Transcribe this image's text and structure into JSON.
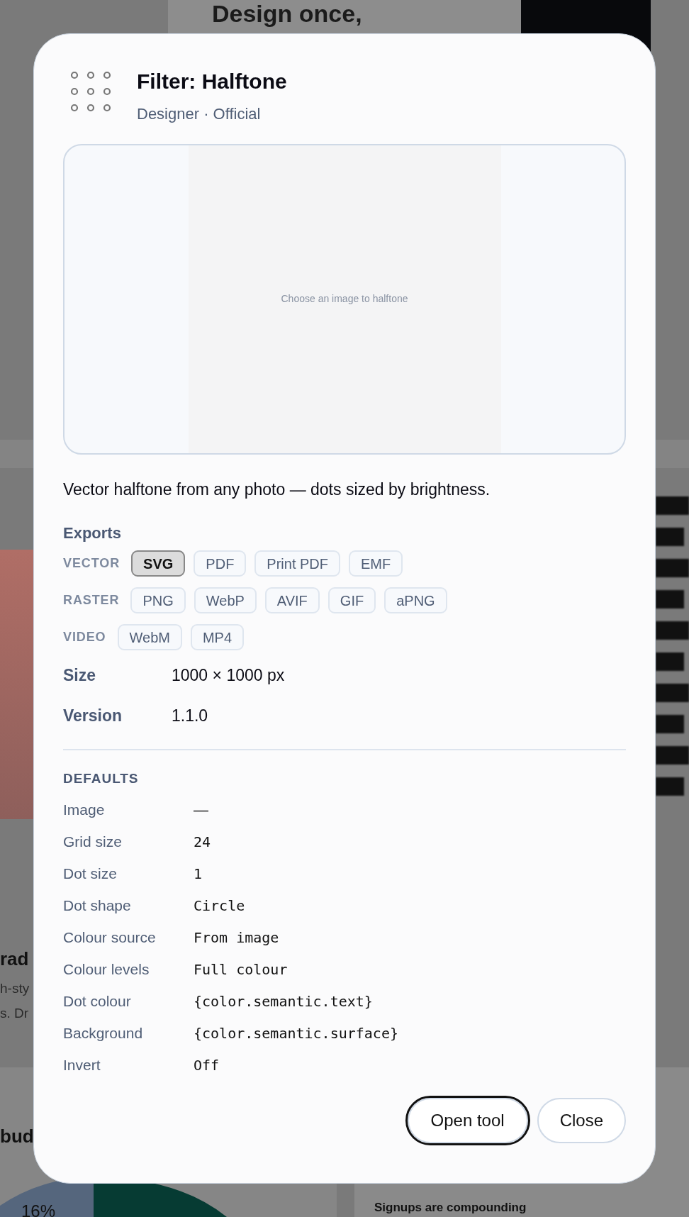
{
  "background": {
    "headline": "Design once,",
    "fragments": [
      {
        "kind": "title",
        "text": "rad"
      },
      {
        "kind": "body",
        "text": "h-sty"
      },
      {
        "kind": "body",
        "text": "s. Dr"
      },
      {
        "kind": "title",
        "text": "bud"
      }
    ],
    "chart_label": "16%",
    "card_title": "Signups are compounding"
  },
  "dialog": {
    "title": "Filter: Halftone",
    "subtitle": "Designer · Official",
    "preview_placeholder": "Choose an image to halftone",
    "description": "Vector halftone from any photo — dots sized by brightness.",
    "exports_heading": "Exports",
    "export_groups": [
      {
        "label": "VECTOR",
        "formats": [
          {
            "label": "SVG",
            "selected": true
          },
          {
            "label": "PDF",
            "selected": false
          },
          {
            "label": "Print PDF",
            "selected": false
          },
          {
            "label": "EMF",
            "selected": false
          }
        ]
      },
      {
        "label": "RASTER",
        "formats": [
          {
            "label": "PNG",
            "selected": false
          },
          {
            "label": "WebP",
            "selected": false
          },
          {
            "label": "AVIF",
            "selected": false
          },
          {
            "label": "GIF",
            "selected": false
          },
          {
            "label": "aPNG",
            "selected": false
          }
        ]
      },
      {
        "label": "VIDEO",
        "formats": [
          {
            "label": "WebM",
            "selected": false
          },
          {
            "label": "MP4",
            "selected": false
          }
        ]
      }
    ],
    "info": [
      {
        "label": "Size",
        "value": "1000 × 1000 px"
      },
      {
        "label": "Version",
        "value": "1.1.0"
      }
    ],
    "defaults_heading": "DEFAULTS",
    "defaults": [
      {
        "label": "Image",
        "value": "—",
        "kind": "text"
      },
      {
        "label": "Grid size",
        "value": "24",
        "kind": "code"
      },
      {
        "label": "Dot size",
        "value": "1",
        "kind": "code"
      },
      {
        "label": "Dot shape",
        "value": "Circle",
        "kind": "code"
      },
      {
        "label": "Colour source",
        "value": "From image",
        "kind": "code"
      },
      {
        "label": "Colour levels",
        "value": "Full colour",
        "kind": "code"
      },
      {
        "label": "Dot colour",
        "value": "{color.semantic.text}",
        "kind": "code"
      },
      {
        "label": "Background",
        "value": "{color.semantic.surface}",
        "kind": "code"
      },
      {
        "label": "Invert",
        "value": "Off",
        "kind": "code"
      }
    ],
    "buttons": [
      {
        "label": "Open tool",
        "kind": "primary"
      },
      {
        "label": "Close",
        "kind": "secondary"
      }
    ]
  }
}
